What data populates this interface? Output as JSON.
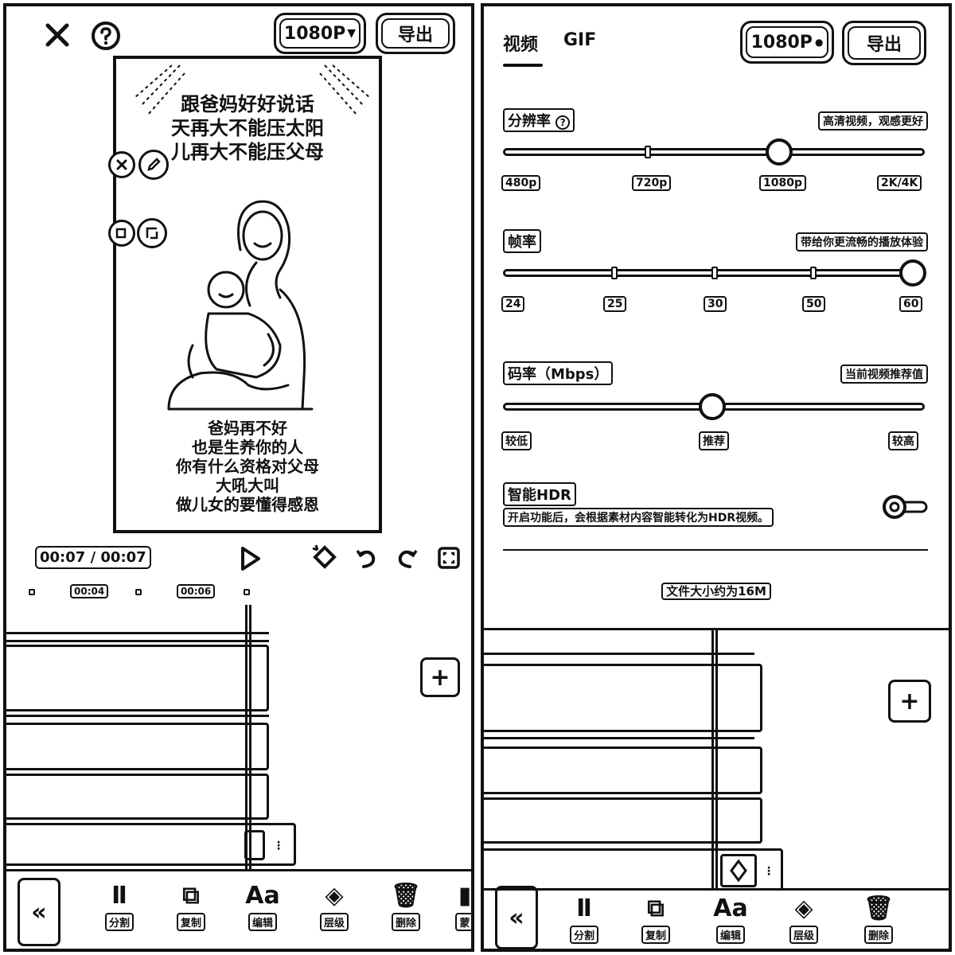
{
  "left": {
    "top_bar": {
      "resolution": "1080P",
      "export": "导出"
    },
    "preview": {
      "caption_top": [
        "跟爸妈好好说话",
        "天再大不能压太阳",
        "儿再大不能压父母"
      ],
      "caption_bottom": [
        "爸妈再不好",
        "也是生养你的人",
        "你有什么资格对父母",
        "大吼大叫",
        "做儿女的要懂得感恩"
      ]
    },
    "timecode": "00:07 / 00:07",
    "ruler": [
      "00:04",
      "00:06"
    ],
    "toolbar": [
      "分割",
      "复制",
      "编辑",
      "层级",
      "删除",
      "蒙"
    ]
  },
  "right": {
    "tabs": [
      "视频",
      "GIF"
    ],
    "top_bar": {
      "resolution": "1080P",
      "export": "导出"
    },
    "resolution": {
      "title": "分辨率",
      "hint": "高清视频，观感更好",
      "ticks": [
        "480p",
        "720p",
        "1080p",
        "2K/4K"
      ],
      "selected": "1080p"
    },
    "framerate": {
      "title": "帧率",
      "hint": "带给你更流畅的播放体验",
      "ticks": [
        "24",
        "25",
        "30",
        "50",
        "60"
      ],
      "selected": "60"
    },
    "bitrate": {
      "title": "码率（Mbps）",
      "hint": "当前视频推荐值",
      "ticks": [
        "较低",
        "推荐",
        "较高"
      ],
      "selected": "推荐"
    },
    "hdr": {
      "title": "智能HDR",
      "desc": "开启功能后，会根据素材内容智能转化为HDR视频。",
      "enabled": false
    },
    "file_size": "文件大小约为16M",
    "toolbar": [
      "分割",
      "复制",
      "编辑",
      "层级",
      "删除"
    ]
  }
}
